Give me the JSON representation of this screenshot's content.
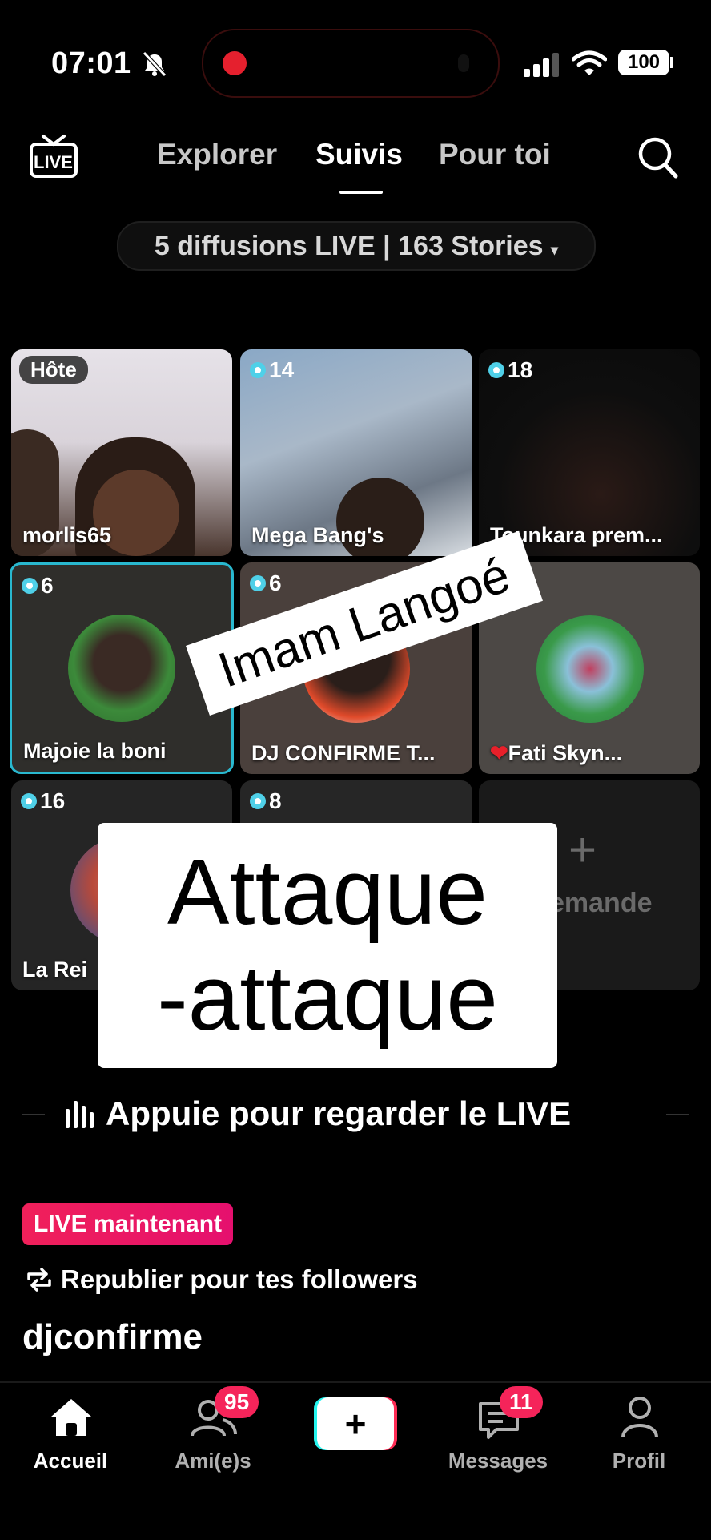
{
  "status_bar": {
    "time": "07:01",
    "battery": "100"
  },
  "top_nav": {
    "live_label": "LIVE",
    "tabs": [
      {
        "label": "Explorer"
      },
      {
        "label": "Suivis"
      },
      {
        "label": "Pour toi"
      }
    ],
    "active_tab": "Suivis"
  },
  "summary_pill": {
    "text": "5 diffusions LIVE | 163 Stories",
    "caret": "▾"
  },
  "grid": {
    "cards": [
      {
        "badge": "Hôte",
        "name": "morlis65"
      },
      {
        "count": "14",
        "name": "Mega Bang's"
      },
      {
        "count": "18",
        "name": "Tounkara prem..."
      },
      {
        "count": "6",
        "name": "Majoie la boni"
      },
      {
        "count": "6",
        "name": "DJ CONFIRME T..."
      },
      {
        "count": "16",
        "name": "Fati Skyn..."
      },
      {
        "count": "16",
        "name": "La Rei"
      },
      {
        "count": "8",
        "name": ""
      },
      {
        "add_symbol": "+",
        "name": "emande"
      }
    ]
  },
  "overlays": {
    "small_sticker": "Imam Langoé",
    "big_sticker_line1": "Attaque",
    "big_sticker_line2": "-attaque"
  },
  "watch_prompt": {
    "text": "Appuie pour regarder le LIVE"
  },
  "live_info": {
    "badge": "LIVE maintenant",
    "repost": "Republier pour tes followers",
    "username": "djconfirme"
  },
  "tab_bar": {
    "items": [
      {
        "label": "Accueil",
        "icon": "home-icon"
      },
      {
        "label": "Ami(e)s",
        "icon": "friends-icon",
        "badge": "95"
      },
      {
        "label": "",
        "icon": "create-icon"
      },
      {
        "label": "Messages",
        "icon": "messages-icon",
        "badge": "11"
      },
      {
        "label": "Profil",
        "icon": "profile-icon"
      }
    ]
  },
  "colors": {
    "accent_live": "#f0205a",
    "teal": "#4fd0e8",
    "background": "#000000"
  }
}
